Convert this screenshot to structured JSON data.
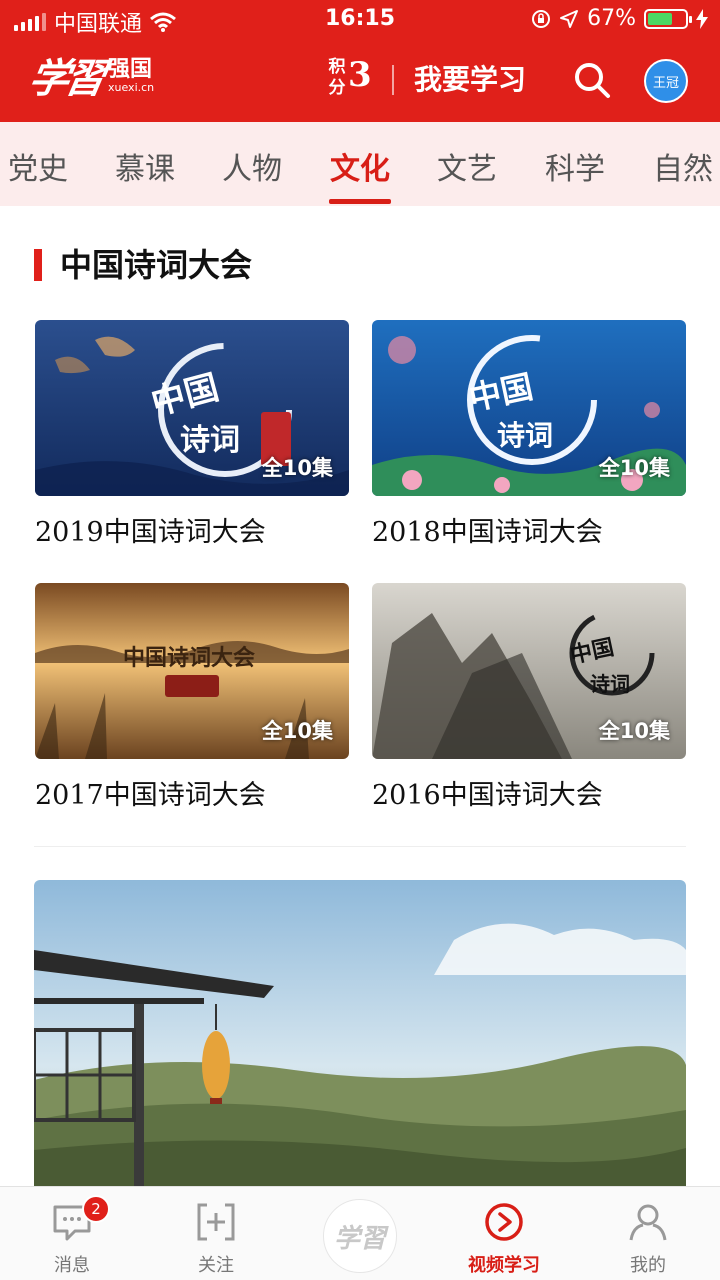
{
  "status_bar": {
    "carrier": "中国联通",
    "time": "16:15",
    "battery": "67%",
    "battery_level": 0.67
  },
  "header": {
    "logo_script": "学習",
    "logo_name": "强国",
    "logo_domain": "xuexi.cn",
    "score_label": "积分",
    "score_value": "3",
    "study_button": "我要学习",
    "avatar_text": "王冠"
  },
  "tabs": [
    {
      "label": "党史"
    },
    {
      "label": "慕课"
    },
    {
      "label": "人物"
    },
    {
      "label": "文化",
      "active": true
    },
    {
      "label": "文艺"
    },
    {
      "label": "科学"
    },
    {
      "label": "自然"
    }
  ],
  "section": {
    "title": "中国诗词大会",
    "cards": [
      {
        "title": "2019中国诗词大会",
        "episodes": "全10集"
      },
      {
        "title": "2018中国诗词大会",
        "episodes": "全10集"
      },
      {
        "title": "2017中国诗词大会",
        "episodes": "全10集"
      },
      {
        "title": "2016中国诗词大会",
        "episodes": "全10集"
      }
    ]
  },
  "bottom_nav": {
    "items": [
      {
        "label": "消息",
        "badge": "2"
      },
      {
        "label": "关注"
      },
      {
        "label": "视频学习",
        "active": true
      },
      {
        "label": "我的"
      }
    ],
    "center_logo": "学習"
  },
  "colors": {
    "brand_red": "#e0201a",
    "tab_background": "#fcecec"
  }
}
